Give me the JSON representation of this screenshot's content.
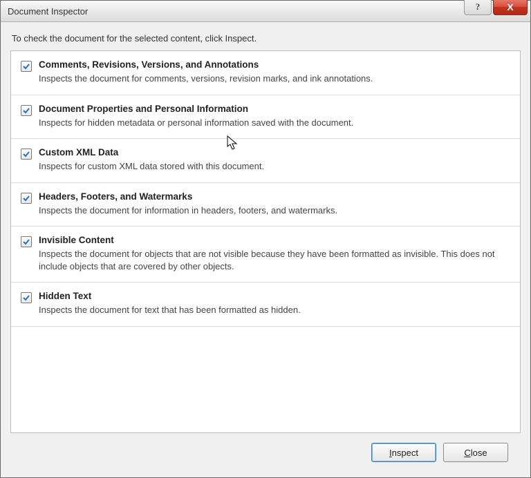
{
  "titlebar": {
    "title": "Document Inspector",
    "help_label": "?",
    "close_label": "X"
  },
  "instruction": "To check the document for the selected content, click Inspect.",
  "items": [
    {
      "checked": true,
      "title": "Comments, Revisions, Versions, and Annotations",
      "desc": "Inspects the document for comments, versions, revision marks, and ink annotations."
    },
    {
      "checked": true,
      "title": "Document Properties and Personal Information",
      "desc": "Inspects for hidden metadata or personal information saved with the document."
    },
    {
      "checked": true,
      "title": "Custom XML Data",
      "desc": "Inspects for custom XML data stored with this document."
    },
    {
      "checked": true,
      "title": "Headers, Footers, and Watermarks",
      "desc": "Inspects the document for information in headers, footers, and watermarks."
    },
    {
      "checked": true,
      "title": "Invisible Content",
      "desc": "Inspects the document for objects that are not visible because they have been formatted as invisible. This does not include objects that are covered by other objects."
    },
    {
      "checked": true,
      "title": "Hidden Text",
      "desc": "Inspects the document for text that has been formatted as hidden."
    }
  ],
  "footer": {
    "inspect_label": "Inspect",
    "close_label": "Close"
  }
}
